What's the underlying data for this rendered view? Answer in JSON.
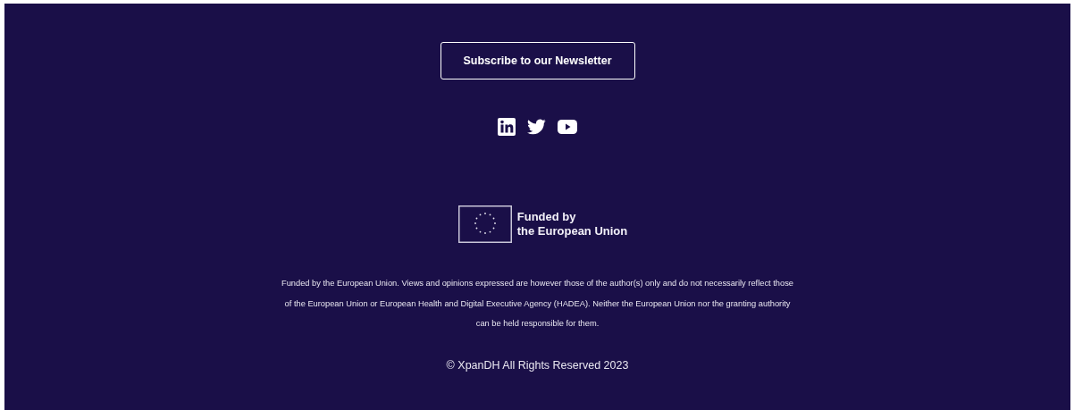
{
  "newsletter_button": {
    "label": "Subscribe to our Newsletter"
  },
  "eu_badge": {
    "lines": [
      "Funded by",
      "the European Union"
    ]
  },
  "disclaimer": "Funded by the European Union. Views and opinions expressed are however those of the author(s) only and do not necessarily reflect those of the European Union or European Health and Digital Executive Agency (HADEA). Neither the European Union nor the granting authority can be held responsible for them.",
  "copyright": "© XpanDH All Rights Reserved 2023"
}
